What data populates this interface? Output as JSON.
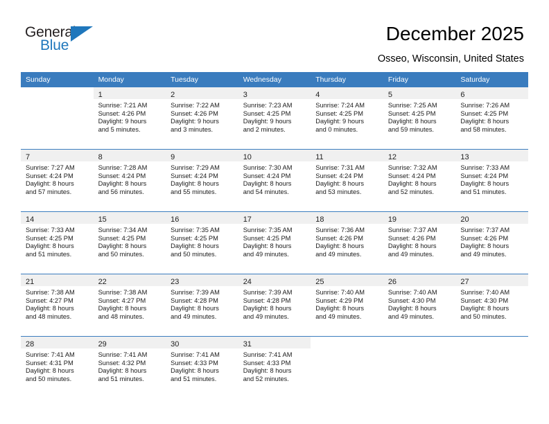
{
  "brand": {
    "name_top": "General",
    "name_bottom": "Blue",
    "flag_icon": "triangle-flag-icon",
    "color_top": "#231f20",
    "color_bottom": "#1f77bc"
  },
  "header": {
    "title": "December 2025",
    "location": "Osseo, Wisconsin, United States"
  },
  "theme": {
    "header_bg": "#3a7cbe",
    "header_text": "#ffffff",
    "daynum_band_bg": "#f0f0f0",
    "cell_bg": "#ffffff",
    "separator": "#3a7cbe"
  },
  "calendar": {
    "weekday_headers": [
      "Sunday",
      "Monday",
      "Tuesday",
      "Wednesday",
      "Thursday",
      "Friday",
      "Saturday"
    ],
    "weeks": [
      [
        {
          "day": "",
          "blank": true,
          "lines": []
        },
        {
          "day": "1",
          "lines": [
            "Sunrise: 7:21 AM",
            "Sunset: 4:26 PM",
            "Daylight: 9 hours",
            "and 5 minutes."
          ]
        },
        {
          "day": "2",
          "lines": [
            "Sunrise: 7:22 AM",
            "Sunset: 4:26 PM",
            "Daylight: 9 hours",
            "and 3 minutes."
          ]
        },
        {
          "day": "3",
          "lines": [
            "Sunrise: 7:23 AM",
            "Sunset: 4:25 PM",
            "Daylight: 9 hours",
            "and 2 minutes."
          ]
        },
        {
          "day": "4",
          "lines": [
            "Sunrise: 7:24 AM",
            "Sunset: 4:25 PM",
            "Daylight: 9 hours",
            "and 0 minutes."
          ]
        },
        {
          "day": "5",
          "lines": [
            "Sunrise: 7:25 AM",
            "Sunset: 4:25 PM",
            "Daylight: 8 hours",
            "and 59 minutes."
          ]
        },
        {
          "day": "6",
          "lines": [
            "Sunrise: 7:26 AM",
            "Sunset: 4:25 PM",
            "Daylight: 8 hours",
            "and 58 minutes."
          ]
        }
      ],
      [
        {
          "day": "7",
          "lines": [
            "Sunrise: 7:27 AM",
            "Sunset: 4:24 PM",
            "Daylight: 8 hours",
            "and 57 minutes."
          ]
        },
        {
          "day": "8",
          "lines": [
            "Sunrise: 7:28 AM",
            "Sunset: 4:24 PM",
            "Daylight: 8 hours",
            "and 56 minutes."
          ]
        },
        {
          "day": "9",
          "lines": [
            "Sunrise: 7:29 AM",
            "Sunset: 4:24 PM",
            "Daylight: 8 hours",
            "and 55 minutes."
          ]
        },
        {
          "day": "10",
          "lines": [
            "Sunrise: 7:30 AM",
            "Sunset: 4:24 PM",
            "Daylight: 8 hours",
            "and 54 minutes."
          ]
        },
        {
          "day": "11",
          "lines": [
            "Sunrise: 7:31 AM",
            "Sunset: 4:24 PM",
            "Daylight: 8 hours",
            "and 53 minutes."
          ]
        },
        {
          "day": "12",
          "lines": [
            "Sunrise: 7:32 AM",
            "Sunset: 4:24 PM",
            "Daylight: 8 hours",
            "and 52 minutes."
          ]
        },
        {
          "day": "13",
          "lines": [
            "Sunrise: 7:33 AM",
            "Sunset: 4:24 PM",
            "Daylight: 8 hours",
            "and 51 minutes."
          ]
        }
      ],
      [
        {
          "day": "14",
          "lines": [
            "Sunrise: 7:33 AM",
            "Sunset: 4:25 PM",
            "Daylight: 8 hours",
            "and 51 minutes."
          ]
        },
        {
          "day": "15",
          "lines": [
            "Sunrise: 7:34 AM",
            "Sunset: 4:25 PM",
            "Daylight: 8 hours",
            "and 50 minutes."
          ]
        },
        {
          "day": "16",
          "lines": [
            "Sunrise: 7:35 AM",
            "Sunset: 4:25 PM",
            "Daylight: 8 hours",
            "and 50 minutes."
          ]
        },
        {
          "day": "17",
          "lines": [
            "Sunrise: 7:35 AM",
            "Sunset: 4:25 PM",
            "Daylight: 8 hours",
            "and 49 minutes."
          ]
        },
        {
          "day": "18",
          "lines": [
            "Sunrise: 7:36 AM",
            "Sunset: 4:26 PM",
            "Daylight: 8 hours",
            "and 49 minutes."
          ]
        },
        {
          "day": "19",
          "lines": [
            "Sunrise: 7:37 AM",
            "Sunset: 4:26 PM",
            "Daylight: 8 hours",
            "and 49 minutes."
          ]
        },
        {
          "day": "20",
          "lines": [
            "Sunrise: 7:37 AM",
            "Sunset: 4:26 PM",
            "Daylight: 8 hours",
            "and 49 minutes."
          ]
        }
      ],
      [
        {
          "day": "21",
          "lines": [
            "Sunrise: 7:38 AM",
            "Sunset: 4:27 PM",
            "Daylight: 8 hours",
            "and 48 minutes."
          ]
        },
        {
          "day": "22",
          "lines": [
            "Sunrise: 7:38 AM",
            "Sunset: 4:27 PM",
            "Daylight: 8 hours",
            "and 48 minutes."
          ]
        },
        {
          "day": "23",
          "lines": [
            "Sunrise: 7:39 AM",
            "Sunset: 4:28 PM",
            "Daylight: 8 hours",
            "and 49 minutes."
          ]
        },
        {
          "day": "24",
          "lines": [
            "Sunrise: 7:39 AM",
            "Sunset: 4:28 PM",
            "Daylight: 8 hours",
            "and 49 minutes."
          ]
        },
        {
          "day": "25",
          "lines": [
            "Sunrise: 7:40 AM",
            "Sunset: 4:29 PM",
            "Daylight: 8 hours",
            "and 49 minutes."
          ]
        },
        {
          "day": "26",
          "lines": [
            "Sunrise: 7:40 AM",
            "Sunset: 4:30 PM",
            "Daylight: 8 hours",
            "and 49 minutes."
          ]
        },
        {
          "day": "27",
          "lines": [
            "Sunrise: 7:40 AM",
            "Sunset: 4:30 PM",
            "Daylight: 8 hours",
            "and 50 minutes."
          ]
        }
      ],
      [
        {
          "day": "28",
          "lines": [
            "Sunrise: 7:41 AM",
            "Sunset: 4:31 PM",
            "Daylight: 8 hours",
            "and 50 minutes."
          ]
        },
        {
          "day": "29",
          "lines": [
            "Sunrise: 7:41 AM",
            "Sunset: 4:32 PM",
            "Daylight: 8 hours",
            "and 51 minutes."
          ]
        },
        {
          "day": "30",
          "lines": [
            "Sunrise: 7:41 AM",
            "Sunset: 4:33 PM",
            "Daylight: 8 hours",
            "and 51 minutes."
          ]
        },
        {
          "day": "31",
          "lines": [
            "Sunrise: 7:41 AM",
            "Sunset: 4:33 PM",
            "Daylight: 8 hours",
            "and 52 minutes."
          ]
        },
        {
          "day": "",
          "blank": true,
          "lines": []
        },
        {
          "day": "",
          "blank": true,
          "lines": []
        },
        {
          "day": "",
          "blank": true,
          "lines": []
        }
      ]
    ]
  }
}
